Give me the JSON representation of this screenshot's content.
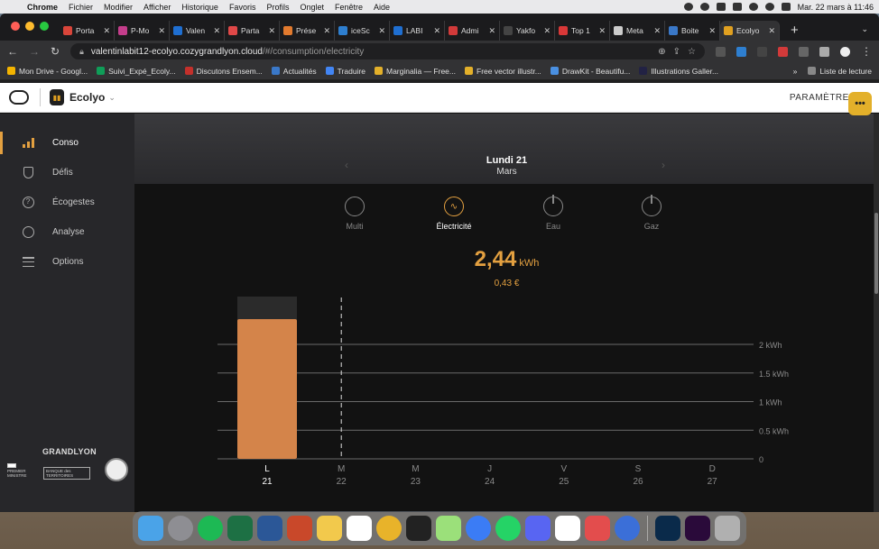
{
  "menubar": {
    "app": "Chrome",
    "items": [
      "Fichier",
      "Modifier",
      "Afficher",
      "Historique",
      "Favoris",
      "Profils",
      "Onglet",
      "Fenêtre",
      "Aide"
    ],
    "clock": "Mar. 22 mars à 11:46"
  },
  "tabs": [
    {
      "label": "Porta",
      "color": "#d9453a"
    },
    {
      "label": "P-Mo",
      "color": "#c43d8b"
    },
    {
      "label": "Valen",
      "color": "#1f6fd1"
    },
    {
      "label": "Parta",
      "color": "#e04848"
    },
    {
      "label": "Prése",
      "color": "#e27a2e"
    },
    {
      "label": "iceSc",
      "color": "#2e7fd0"
    },
    {
      "label": "LABI",
      "color": "#1f6fd1"
    },
    {
      "label": "Admi",
      "color": "#d23a3a"
    },
    {
      "label": "Yakfo",
      "color": "#444444"
    },
    {
      "label": "Top 1",
      "color": "#d93838"
    },
    {
      "label": "Meta",
      "color": "#cccccc"
    },
    {
      "label": "Boite",
      "color": "#3a78c8"
    },
    {
      "label": "Ecolyo",
      "color": "#e0a020",
      "active": true
    }
  ],
  "url": {
    "host": "valentinlabit12-ecolyo.cozygrandlyon.cloud",
    "path": "/#/consumption/electricity"
  },
  "bookmarks": [
    {
      "label": "Mon Drive - Googl...",
      "color": "#f4b400"
    },
    {
      "label": "Suivi_Expé_Ecoly...",
      "color": "#0f9d58"
    },
    {
      "label": "Discutons Ensem...",
      "color": "#c4302b"
    },
    {
      "label": "Actualités",
      "color": "#3a78c8"
    },
    {
      "label": "Traduire",
      "color": "#4285f4"
    },
    {
      "label": "Marginalia — Free...",
      "color": "#e3b02a"
    },
    {
      "label": "Free vector illustr...",
      "color": "#e3b02a"
    },
    {
      "label": "DrawKit - Beautifu...",
      "color": "#4a90e2"
    },
    {
      "label": "Illustrations Galler...",
      "color": "#222244"
    }
  ],
  "bookmarks_more": "»",
  "reading_list": "Liste de lecture",
  "app": {
    "name": "Ecolyo",
    "settings": "PARAMÈTRES"
  },
  "sidebar": {
    "items": [
      {
        "label": "Conso",
        "icon": "bars-icon",
        "active": true
      },
      {
        "label": "Défis",
        "icon": "shield-icon"
      },
      {
        "label": "Écogestes",
        "icon": "help-circle-icon"
      },
      {
        "label": "Analyse",
        "icon": "pie-icon"
      },
      {
        "label": "Options",
        "icon": "sliders-icon"
      }
    ],
    "grandlyon": "GRANDLYON",
    "pm": "PREMIER MINISTRE",
    "bt": "BANQUE des TERRITOIRES"
  },
  "date": {
    "day": "Lundi 21",
    "month": "Mars"
  },
  "fluids": [
    {
      "label": "Multi",
      "active": false
    },
    {
      "label": "Électricité",
      "active": true
    },
    {
      "label": "Eau",
      "active": false
    },
    {
      "label": "Gaz",
      "active": false
    }
  ],
  "value": {
    "amount": "2,44",
    "unit": "kWh",
    "price": "0,43 €"
  },
  "colors": {
    "accent": "#e3a040",
    "bar": "#d4844a"
  },
  "chart_data": {
    "type": "bar",
    "categories": [
      "L",
      "M",
      "M",
      "J",
      "V",
      "S",
      "D"
    ],
    "dates": [
      "21",
      "22",
      "23",
      "24",
      "25",
      "26",
      "27"
    ],
    "values": [
      2.44,
      null,
      null,
      null,
      null,
      null,
      null
    ],
    "ylabel": "",
    "ytick_labels": [
      "2 kWh",
      "1.5 kWh",
      "1 kWh",
      "0.5 kWh",
      "0"
    ],
    "ytick_values": [
      2,
      1.5,
      1,
      0.5,
      0
    ],
    "ylim": [
      0,
      2.5
    ],
    "today_index": 1,
    "grid": true
  }
}
